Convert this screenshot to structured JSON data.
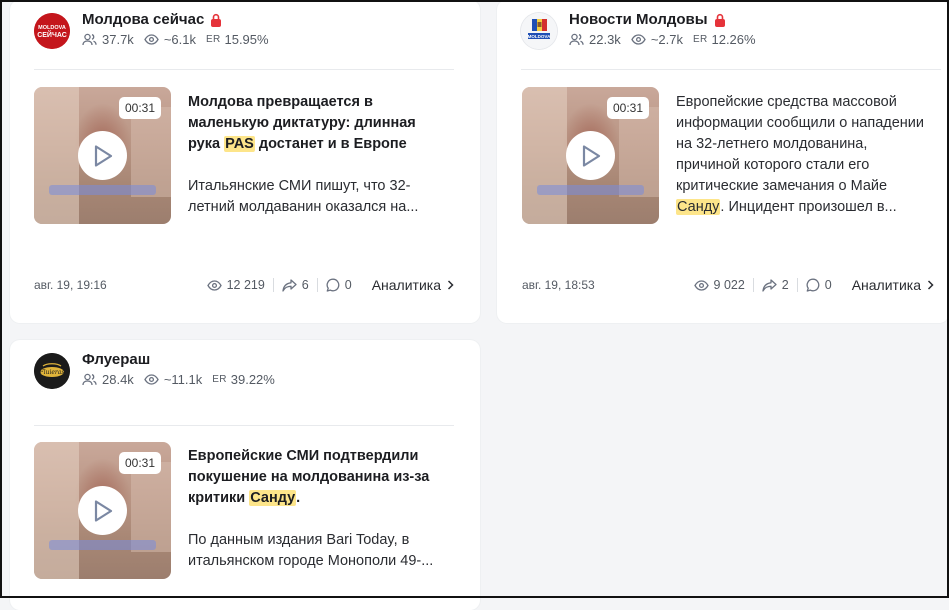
{
  "posts": [
    {
      "channel_name": "Молдова сейчас",
      "avatar_text": "MOLDOVA СЕЙЧАС",
      "subscribers": "37.7k",
      "views_avg": "~6.1k",
      "er_label": "ER",
      "er": "15.95%",
      "duration": "00:31",
      "title_a": "Молдова превращается в маленькую диктатуру: длинная рука ",
      "title_hl": "PAS",
      "title_b": " достанет и в Европе",
      "excerpt_a": "Итальянские СМИ пишут, что 32-летний молдаванин оказался на...",
      "excerpt_hl": "",
      "excerpt_b": "",
      "date": "авг. 19, 19:16",
      "views": "12 219",
      "shares": "6",
      "comments": "0",
      "analytics": "Аналитика"
    },
    {
      "channel_name": "Новости Молдовы",
      "avatar_text": "MOLDOVA",
      "subscribers": "22.3k",
      "views_avg": "~2.7k",
      "er_label": "ER",
      "er": "12.26%",
      "duration": "00:31",
      "title_a": "",
      "title_hl": "",
      "title_b": "",
      "excerpt_a": "Европейские средства массовой информации сообщили о нападении на 32-летнего молдованина, причиной которого стали его критические замечания о Майе ",
      "excerpt_hl": "Санду",
      "excerpt_b": ". Инцидент произошел в...",
      "date": "авг. 19, 18:53",
      "views": "9 022",
      "shares": "2",
      "comments": "0",
      "analytics": "Аналитика"
    },
    {
      "channel_name": "Флуераш",
      "avatar_text": "Fluieraș",
      "subscribers": "28.4k",
      "views_avg": "~11.1k",
      "er_label": "ER",
      "er": "39.22%",
      "duration": "00:31",
      "title_a": "Европейские СМИ подтвердили покушение на молдованина из-за критики ",
      "title_hl": "Санду",
      "title_b": ".",
      "excerpt_a": "По данным издания Bari Today, в итальянском городе Монополи 49-...",
      "excerpt_hl": "",
      "excerpt_b": ""
    }
  ],
  "colors": {
    "highlight": "#fde58a",
    "card_bg": "#ffffff",
    "page_bg": "#f4f5f7",
    "lock_red": "#e5333a",
    "text_muted": "#545a63"
  },
  "icons": [
    "lock-icon",
    "subscribers-icon",
    "eye-icon",
    "play-icon",
    "share-icon",
    "comment-icon",
    "chevron-right-icon"
  ]
}
